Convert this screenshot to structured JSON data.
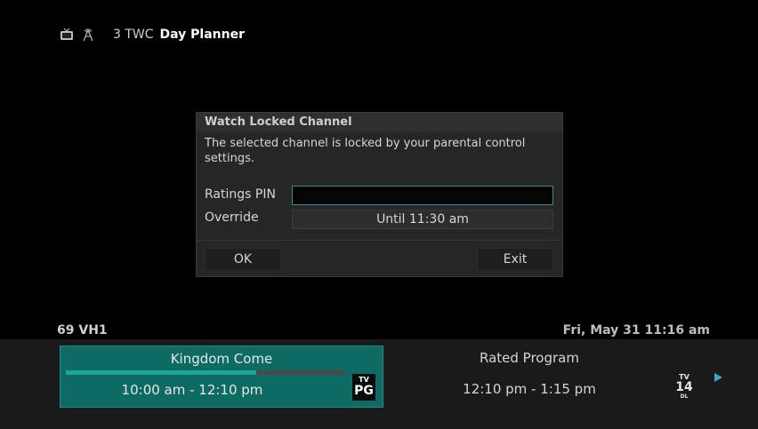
{
  "header": {
    "channel": "3 TWC",
    "title": "Day Planner",
    "icons": [
      "tv-icon",
      "antenna-icon"
    ]
  },
  "dialog": {
    "title": "Watch Locked Channel",
    "message": "The selected channel is locked by your parental control settings.",
    "pin_label": "Ratings PIN",
    "pin_value": "",
    "override_label": "Override",
    "override_value": "Until 11:30 am",
    "ok_label": "OK",
    "exit_label": "Exit"
  },
  "info": {
    "channel": "69 VH1",
    "datetime": "Fri, May 31 11:16 am"
  },
  "current_program": {
    "title": "Kingdom Come",
    "time": "10:00 am - 12:10 pm",
    "rating_tv": "TV",
    "rating": "PG",
    "progress": 0.68
  },
  "next_program": {
    "title": "Rated Program",
    "time": "12:10 pm - 1:15 pm",
    "rating_tv": "TV",
    "rating": "14",
    "rating_sub": "DL"
  },
  "colors": {
    "accent": "#0e6b63",
    "progress": "#1fa594",
    "arrow": "#3aa6c9"
  }
}
